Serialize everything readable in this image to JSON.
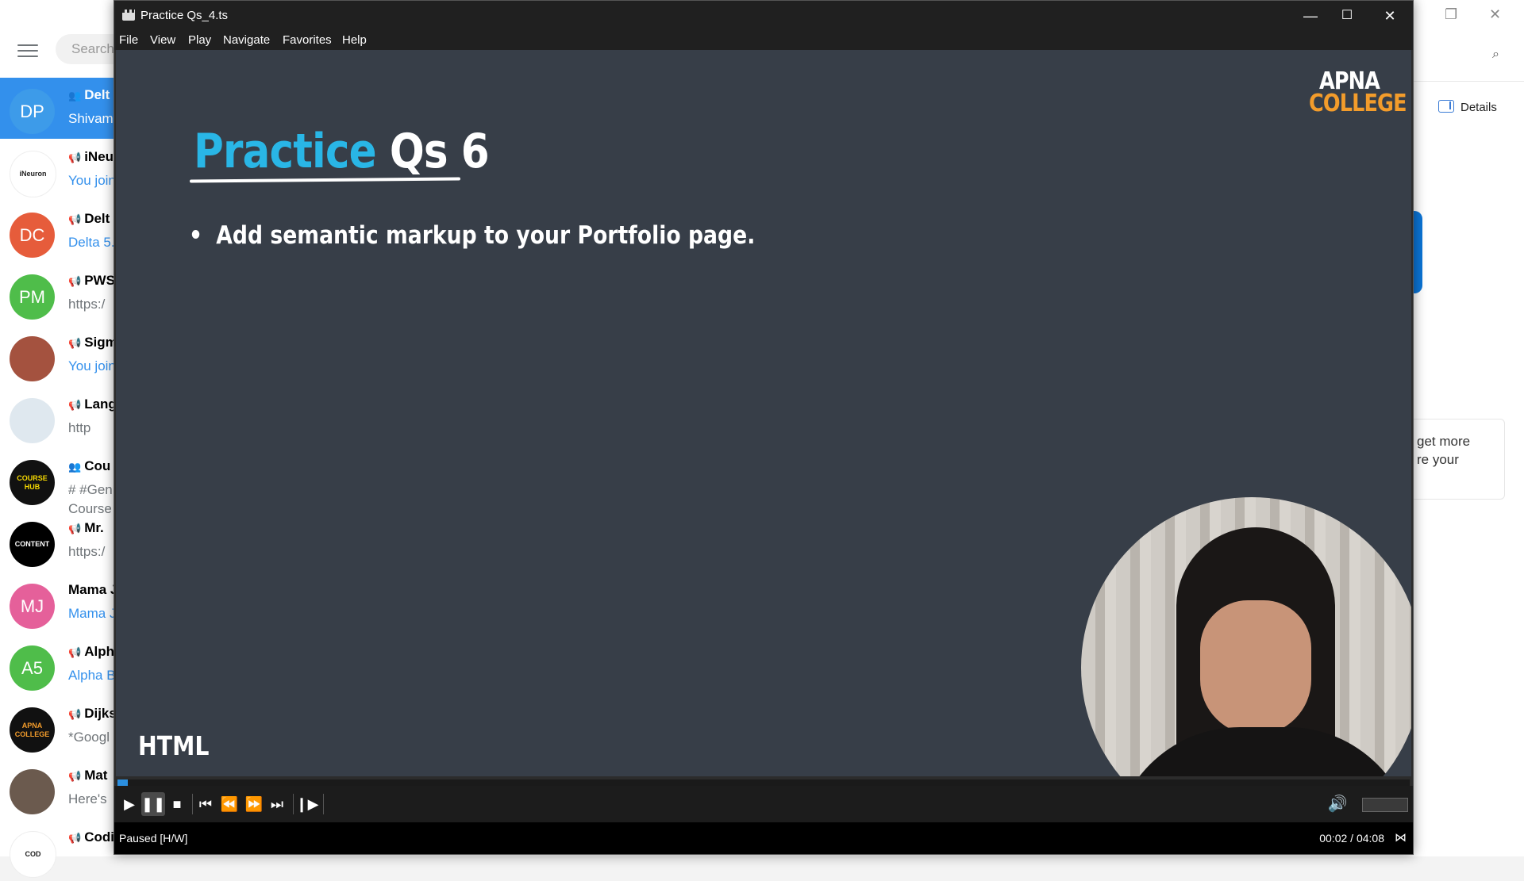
{
  "background_app": {
    "search_placeholder": "Search",
    "details_label": "Details",
    "card_text_1": "get more",
    "card_text_2": "re your",
    "chats": [
      {
        "avatar_text": "DP",
        "avatar_color": "#3d9be9",
        "title": "Delt",
        "preview": "Shivam",
        "preview_style": "blue",
        "icon": "group-icon",
        "active": true
      },
      {
        "avatar_text": "iNeuron",
        "avatar_color": "#ffffff",
        "title": "iNeu",
        "preview": "You join",
        "preview_style": "blue",
        "icon": "megaphone-icon"
      },
      {
        "avatar_text": "DC",
        "avatar_color": "#e65c3b",
        "title": "Delt",
        "preview": "Delta 5.",
        "preview_style": "blue",
        "icon": "megaphone-icon"
      },
      {
        "avatar_text": "PM",
        "avatar_color": "#4fbd4a",
        "title": "PWS",
        "preview": "https:/",
        "preview_style": "grey",
        "icon": "megaphone-icon"
      },
      {
        "avatar_text": "",
        "avatar_color": "#a4523f",
        "title": "Sigm",
        "preview": "You join",
        "preview_style": "blue",
        "icon": "megaphone-icon"
      },
      {
        "avatar_text": "",
        "avatar_color": "#dfe8ef",
        "title": "Lang",
        "preview": "http",
        "preview_style": "grey",
        "icon": "megaphone-icon"
      },
      {
        "avatar_text": "COURSE HUB",
        "avatar_color": "#111111",
        "title": "Cou",
        "preview": "# #Gen",
        "preview2": "Course",
        "preview_style": "grey",
        "icon": "group-icon"
      },
      {
        "avatar_text": "CONTENT",
        "avatar_color": "#000000",
        "title": "Mr.",
        "preview": "https:/",
        "preview_style": "grey",
        "icon": "megaphone-icon"
      },
      {
        "avatar_text": "MJ",
        "avatar_color": "#e5609a",
        "title": "Mama J",
        "preview": "Mama J",
        "preview_style": "blue",
        "icon": ""
      },
      {
        "avatar_text": "A5",
        "avatar_color": "#4fbd4a",
        "title": "Alph",
        "preview": "Alpha B",
        "preview_style": "blue",
        "icon": "megaphone-icon"
      },
      {
        "avatar_text": "APNA COLLEGE",
        "avatar_color": "#111111",
        "title": "Dijks",
        "preview": "*Googl",
        "preview_style": "grey",
        "icon": "megaphone-icon"
      },
      {
        "avatar_text": "",
        "avatar_color": "#6b5a4e",
        "title": "Mat",
        "preview": "Here's",
        "preview_style": "grey",
        "icon": "megaphone-icon"
      },
      {
        "avatar_text": "COD",
        "avatar_color": "#ffffff",
        "title": "Codi",
        "preview": "",
        "preview_style": "grey",
        "icon": "megaphone-icon"
      }
    ]
  },
  "player": {
    "window_title": "Practice Qs_4.ts",
    "menu": [
      "File",
      "View",
      "Play",
      "Navigate",
      "Favorites",
      "Help"
    ],
    "slide": {
      "title_part1": "Practice",
      "title_part2": "Qs 6",
      "bullet": "Add semantic markup to your Portfolio page.",
      "logo_line1": "APNA",
      "logo_line2": "COLLEGE",
      "corner_label": "HTML"
    },
    "seek_progress_fraction": 0.008,
    "volume_fraction": 0.0,
    "status_left": "Paused [H/W]",
    "status_right": "00:02 / 04:08",
    "colors": {
      "accent": "#2b8fe0",
      "title_blue": "#29b6e6",
      "logo_orange": "#f39c2b",
      "slide_bg": "#373e48"
    }
  }
}
